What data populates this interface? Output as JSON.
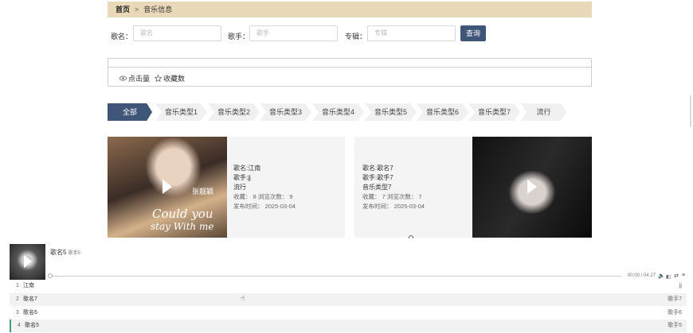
{
  "breadcrumb": {
    "home": "首页",
    "separator": ">",
    "current": "音乐信息"
  },
  "search": {
    "song_label": "歌名：",
    "song_placeholder": "歌名",
    "singer_label": "歌手：",
    "singer_placeholder": "歌手",
    "album_label": "专辑：",
    "album_placeholder": "专辑",
    "query_button": "查询"
  },
  "sort": {
    "clicks": "点击量",
    "favorites": "收藏数"
  },
  "categories": [
    "全部",
    "音乐类型1",
    "音乐类型2",
    "音乐类型3",
    "音乐类型4",
    "音乐类型5",
    "音乐类型6",
    "音乐类型7",
    "流行"
  ],
  "cards": [
    {
      "overlay_artist": "张靓颖",
      "overlay_line1": "Could you",
      "overlay_line2": "stay With me",
      "song": "歌名:江南",
      "singer": "歌手:jj",
      "genre": "流行",
      "stats": "收藏： 8   浏览次数： 9",
      "date": "发布时间： 2025-03-04"
    },
    {
      "song": "歌名:歌名7",
      "singer": "歌手:歌手7",
      "genre": "音乐类型7",
      "stats": "收藏： 7   浏览次数： 7",
      "date": "发布时间： 2025-03-04"
    }
  ],
  "player": {
    "title": "歌名5",
    "artist": "歌手5",
    "time": "00:00 / 04:27",
    "progress": 0,
    "playlist": [
      {
        "num": "1",
        "name": "江南",
        "artist": "jj"
      },
      {
        "num": "2",
        "name": "歌名7",
        "artist": "歌手7"
      },
      {
        "num": "3",
        "name": "歌名6",
        "artist": "歌手6"
      },
      {
        "num": "4",
        "name": "歌名5",
        "artist": "歌手5"
      }
    ]
  },
  "colors": {
    "accent": "#3f5679",
    "breadcrumb_bg": "#ead9b8",
    "current_track": "#3f9e7c"
  }
}
